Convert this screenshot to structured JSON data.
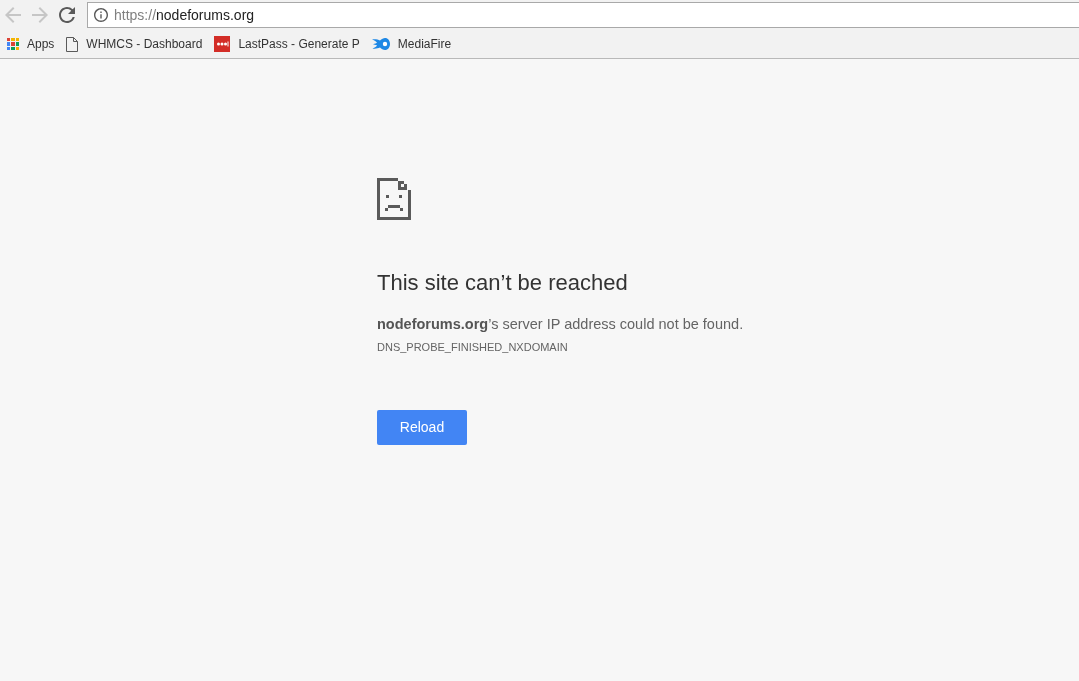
{
  "toolbar": {
    "nav_buttons": [
      {
        "kind": "back",
        "disabled": true
      },
      {
        "kind": "forward",
        "disabled": true
      },
      {
        "kind": "reload",
        "disabled": false
      }
    ],
    "address": {
      "scheme": "https://",
      "host": "nodeforums.org"
    }
  },
  "bookmarks": [
    {
      "kind": "apps",
      "label": "Apps"
    },
    {
      "kind": "page",
      "label": "WHMCS - Dashboard"
    },
    {
      "kind": "lastpass",
      "label": "LastPass - Generate P"
    },
    {
      "kind": "mediafire",
      "label": "MediaFire"
    }
  ],
  "error": {
    "title": "This site can’t be reached",
    "message": "**nodeforums.org**’s server IP address could not be found.",
    "code": "DNS_PROBE_FINISHED_NXDOMAIN",
    "button": "Reload"
  }
}
